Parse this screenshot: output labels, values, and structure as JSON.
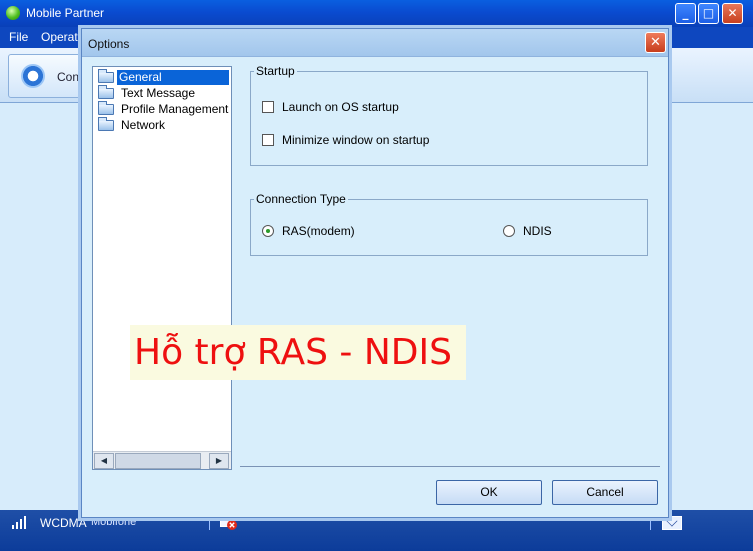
{
  "main_window": {
    "title": "Mobile Partner",
    "menu": {
      "file": "File",
      "operation": "Operati"
    },
    "toolbar": {
      "connect_label": "Con"
    },
    "controls": {
      "minimize": "_",
      "maximize": "□",
      "close": "✕"
    }
  },
  "status_bar": {
    "network": "WCDMA",
    "operator": "Mobifone"
  },
  "options_dialog": {
    "title": "Options",
    "close": "✕",
    "tree": {
      "items": [
        {
          "label": "General",
          "selected": true
        },
        {
          "label": "Text Message",
          "selected": false
        },
        {
          "label": "Profile Management",
          "selected": false
        },
        {
          "label": "Network",
          "selected": false
        }
      ],
      "scroll_left": "◀",
      "scroll_right": "▶"
    },
    "startup": {
      "legend": "Startup",
      "launch_on_os_startup": {
        "label": "Launch on OS startup",
        "checked": false
      },
      "minimize_on_startup": {
        "label": "Minimize window on startup",
        "checked": false
      }
    },
    "connection_type": {
      "legend": "Connection Type",
      "options": [
        {
          "label": "RAS(modem)",
          "selected": true
        },
        {
          "label": "NDIS",
          "selected": false
        }
      ]
    },
    "ok_label": "OK",
    "cancel_label": "Cancel"
  },
  "overlay_caption": "Hỗ trợ RAS - NDIS",
  "colors": {
    "title_bar_blue": "#0a4bd0",
    "dialog_background": "#d8eefb",
    "selection_blue": "#0a64d8",
    "caption_red": "#ee1010",
    "caption_background": "#fafae0"
  }
}
